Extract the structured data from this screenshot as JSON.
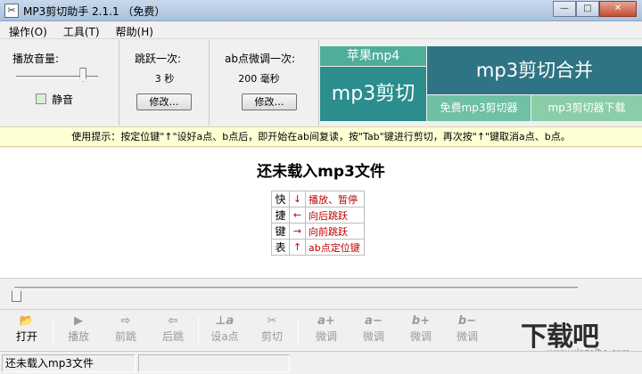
{
  "window": {
    "title": "MP3剪切助手 2.1.1 （免费）",
    "icon_glyph": "✂",
    "buttons": {
      "minimize": "—",
      "maximize": "□",
      "close": "✕"
    }
  },
  "menu": {
    "items": [
      "操作(O)",
      "工具(T)",
      "帮助(H)"
    ]
  },
  "controls": {
    "volume": {
      "label": "播放音量:",
      "level": 0.82,
      "mute_label": "静音",
      "mute_checked": false
    },
    "jump": {
      "label": "跳跃一次:",
      "value": "3 秒",
      "button": "修改…"
    },
    "fine_tune": {
      "label": "ab点微调一次:",
      "value": "200 毫秒",
      "button": "修改…"
    }
  },
  "ads": {
    "apple_mp4": "苹果mp4",
    "mp3_cut": "mp3剪切",
    "mp3_cut_merge": "mp3剪切合并",
    "free_cutter": "免费mp3剪切器",
    "cutter_download": "mp3剪切器下载"
  },
  "tip": "使用提示：按定位键\"↑\"设好a点、b点后，即开始在ab间复读，按\"Tab\"键进行剪切，再次按\"↑\"键取消a点、b点。",
  "main": {
    "status_title": "还未载入mp3文件",
    "shortcut_header": [
      "快",
      "捷",
      "键",
      "表"
    ],
    "shortcuts": [
      {
        "key": "↓",
        "desc": "播放、暂停"
      },
      {
        "key": "←",
        "desc": "向后跳跃"
      },
      {
        "key": "→",
        "desc": "向前跳跃"
      },
      {
        "key": "↑",
        "desc": "ab点定位键"
      }
    ]
  },
  "seek": {
    "position": 0
  },
  "toolbar": {
    "open": {
      "label": "打开",
      "icon": "📂"
    },
    "play": {
      "label": "播放",
      "icon": "▶"
    },
    "back": {
      "label": "前跳",
      "icon": "⇨"
    },
    "forward": {
      "label": "后跳",
      "icon": "⇦"
    },
    "set_point": {
      "label": "设a点",
      "icon": "⊥a"
    },
    "cut": {
      "label": "剪切",
      "icon": "✂"
    },
    "a_plus": {
      "label": "微调",
      "icon": "a+"
    },
    "a_minus": {
      "label": "微调",
      "icon": "a−"
    },
    "b_plus": {
      "label": "微调",
      "icon": "b+"
    },
    "b_minus": {
      "label": "微调",
      "icon": "b−"
    }
  },
  "watermark": {
    "logo": "下载吧",
    "url": "www.xiazaiba.com"
  },
  "statusbar": {
    "message": "还未载入mp3文件"
  },
  "colors": {
    "ad_apple": "#4fae9b",
    "ad_cut": "#2b8d8c",
    "ad_merge": "#2f7484",
    "ad_free": "#6fc0a5",
    "ad_download": "#8ccda9",
    "shortcut_text": "#c00000",
    "tip_bg": "#ffffd4"
  }
}
